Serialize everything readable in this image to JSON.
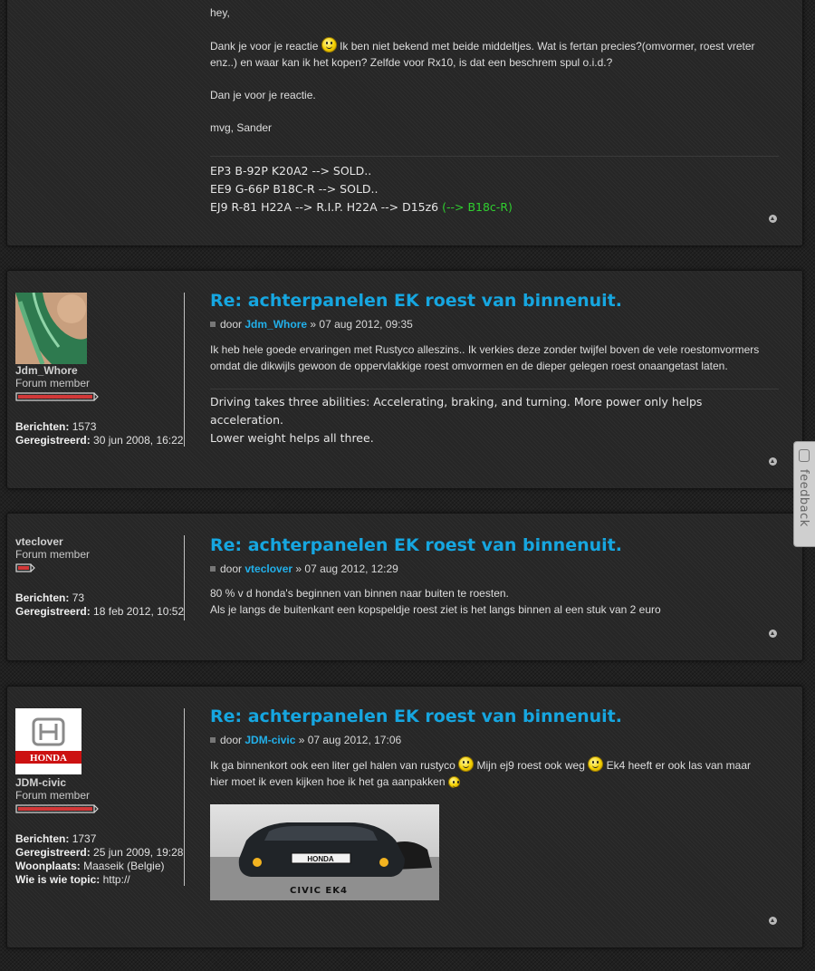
{
  "post1": {
    "greeting": "hey,",
    "line1a": "Dank je voor je reactie ",
    "line1b": " Ik ben niet bekend met beide middeltjes. Wat is fertan precies?(omvormer, roest vreter",
    "line2": "enz..) en waar kan ik het kopen? Zelfde voor Rx10, is dat een beschrem spul o.i.d.?",
    "line3": "Dan je voor je reactie.",
    "line4": "mvg, Sander",
    "sig1": "EP3 B-92P K20A2 --> SOLD..",
    "sig2": "EE9 G-66P B18C-R --> SOLD..",
    "sig3": "EJ9 R-81 H22A --> R.I.P. H22A --> D15z6 ",
    "sig3_green": "(--> B18c-R)"
  },
  "post2": {
    "username": "Jdm_Whore",
    "rank": "Forum member",
    "berichten_label": "Berichten:",
    "berichten": "1573",
    "geregistreerd_label": "Geregistreerd:",
    "geregistreerd": "30 jun 2008, 16:22",
    "title": "Re: achterpanelen EK roest van binnenuit.",
    "by_prefix": "door ",
    "author": "Jdm_Whore",
    "by_date": " » 07 aug 2012, 09:35",
    "text1": "Ik heb hele goede ervaringen met Rustyco alleszins.. Ik verkies deze zonder twijfel boven de vele roestomvormers",
    "text2": "omdat die dikwijls gewoon de oppervlakkige roest omvormen en de dieper gelegen roest onaangetast laten.",
    "sig1": "Driving takes three abilities: Accelerating, braking, and turning. More power only helps acceleration.",
    "sig2": "Lower weight helps all three."
  },
  "post3": {
    "username": "vteclover",
    "rank": "Forum member",
    "berichten_label": "Berichten:",
    "berichten": "73",
    "geregistreerd_label": "Geregistreerd:",
    "geregistreerd": "18 feb 2012, 10:52",
    "title": "Re: achterpanelen EK roest van binnenuit.",
    "by_prefix": "door ",
    "author": "vteclover",
    "by_date": " » 07 aug 2012, 12:29",
    "text1": "80 % v d honda's beginnen van binnen naar buiten te roesten.",
    "text2": "Als je langs de buitenkant een kopspeldje roest ziet is het langs binnen al een stuk van 2 euro"
  },
  "post4": {
    "username": "JDM-civic",
    "rank": "Forum member",
    "berichten_label": "Berichten:",
    "berichten": "1737",
    "geregistreerd_label": "Geregistreerd:",
    "geregistreerd": "25 jun 2009, 19:28",
    "woonplaats_label": "Woonplaats:",
    "woonplaats": "Maaseik (Belgie)",
    "wie_label": "Wie is wie topic:",
    "wie": "http://",
    "avatar_text": "HONDA",
    "title": "Re: achterpanelen EK roest van binnenuit.",
    "by_prefix": "door ",
    "author": "JDM-civic",
    "by_date": " » 07 aug 2012, 17:06",
    "text1a": "Ik ga binnenkort ook een liter gel halen van rustyco ",
    "text1b": " Mijn ej9 roest ook weg ",
    "text1c": " Ek4 heeft er ook las van maar",
    "text2": "hier moet ik even kijken hoe ik het ga aanpakken ",
    "sig_plate": "HONDA",
    "sig_caption": "CIVIC EK4"
  },
  "feedback": {
    "label": "feedback"
  }
}
